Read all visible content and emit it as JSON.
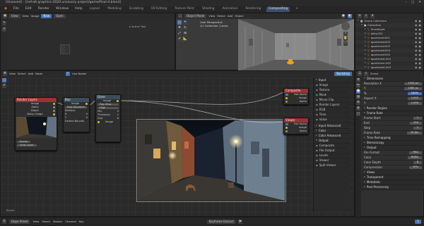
{
  "titlebar": {
    "text": "[Unsaved] - [/ref-alt-graphics-2020.unsavory project/game/final-4.blend]"
  },
  "menubar": {
    "menus": [
      "File",
      "Edit",
      "Render",
      "Window",
      "Help"
    ],
    "workspaces": [
      "Layout",
      "Modeling",
      "Sculpting",
      "UV Editing",
      "Texture Paint",
      "Shading",
      "Animation",
      "Rendering",
      "Compositing"
    ],
    "active_workspace": "Compositing"
  },
  "image_editor_top": {
    "header_items": [
      "View",
      "View",
      "Image",
      "New",
      "Open"
    ],
    "label": "Active Tool"
  },
  "viewport_3d": {
    "header": [
      "Object Mode",
      "View",
      "Select",
      "Add",
      "Object"
    ],
    "info_lines": [
      "User Perspective",
      "(1) Collection | Lamp"
    ],
    "info_text": "Collection | 0.2"
  },
  "outliner": {
    "title": "Scene Collection",
    "items": [
      {
        "name": "Scene Collection",
        "indent": 0
      },
      {
        "name": "Collection",
        "indent": 1
      },
      {
        "name": "Streetlight",
        "indent": 2
      },
      {
        "name": "alley.001",
        "indent": 2
      },
      {
        "name": "apartment001",
        "indent": 2
      },
      {
        "name": "apartment002",
        "indent": 2
      },
      {
        "name": "apartment003",
        "indent": 2
      },
      {
        "name": "apartment004",
        "indent": 2
      },
      {
        "name": "apartment005",
        "indent": 2
      },
      {
        "name": "apartment.001",
        "indent": 2
      },
      {
        "name": "apartment.002",
        "indent": 2
      },
      {
        "name": "apartment.003",
        "indent": 2
      },
      {
        "name": "apartment.004",
        "indent": 2
      }
    ]
  },
  "node_editor": {
    "header": [
      "View",
      "Select",
      "Add",
      "Node",
      "Use Nodes",
      "Backdrop"
    ],
    "nodes": {
      "render_layers": {
        "title": "Render Layers",
        "rows": [
          "Image",
          "Alpha",
          "Depth",
          "Noisy Image"
        ],
        "footer": [
          "Scene",
          "View Layer"
        ]
      },
      "blur": {
        "title": "Blur",
        "rows": [
          "Image",
          "Fast Gaussian",
          "Relative",
          "X",
          "Y",
          "Extend Bounds"
        ]
      },
      "glare": {
        "title": "Glare",
        "rows": [
          "Image",
          "Fog Glow",
          "High",
          "Mix",
          "Threshold",
          "Size"
        ]
      },
      "composite": {
        "title": "Composite",
        "rows": [
          "Use Alpha",
          "Image",
          "Alpha"
        ]
      },
      "viewer": {
        "title": "Viewer",
        "rows": [
          "Use Alpha",
          "Image",
          "Alpha"
        ]
      }
    },
    "add_menu": {
      "title": "Input",
      "items": [
        "Image",
        "Texture",
        "Mask",
        "Movie Clip",
        "Render Layers",
        "RGB",
        "Time",
        "Value"
      ],
      "sections": [
        "Input Advanced",
        "Color",
        "Color Advanced",
        "Output"
      ],
      "output_items": [
        "Composite",
        "File Output",
        "Levels",
        "Viewer",
        "Split Viewer"
      ]
    },
    "bottom_label": "Scene"
  },
  "properties": {
    "tabs": [
      "Scene"
    ],
    "sections": [
      {
        "name": "Dimensions",
        "rows": [
          [
            "Resolution X",
            "1920 px"
          ],
          [
            "Y",
            "1080 px"
          ],
          [
            "%",
            "100%"
          ],
          [
            "Aspect X",
            "1.000"
          ],
          [
            "Y",
            "1.000"
          ]
        ]
      },
      {
        "name": "Render Region",
        "rows": []
      },
      {
        "name": "Frame Rate",
        "rows": [
          [
            "Frame Start",
            "1"
          ],
          [
            "End",
            "250"
          ],
          [
            "Step",
            "1"
          ],
          [
            "Frame Rate",
            "24 fps"
          ]
        ]
      },
      {
        "name": "Time Remapping",
        "rows": []
      },
      {
        "name": "Stereoscopy",
        "rows": []
      },
      {
        "name": "Output",
        "rows": [
          [
            "File Format",
            "PNG"
          ],
          [
            "Color",
            "RGBA"
          ],
          [
            "Color Depth",
            "8"
          ],
          [
            "Compression",
            "15%"
          ]
        ]
      },
      {
        "name": "Views",
        "rows": []
      },
      {
        "name": "Transparent",
        "rows": []
      },
      {
        "name": "Metadata",
        "rows": []
      },
      {
        "name": "Post Processing",
        "rows": []
      }
    ]
  },
  "timeline": {
    "items": [
      "Dope Sheet",
      "View",
      "Select",
      "Marker",
      "Channel",
      "Key",
      "Keyframe Extract"
    ],
    "frame": "1"
  },
  "colors": {
    "accent": "#4772b3",
    "node_input": "#9b3232",
    "node_filter": "#3a4d5c",
    "node_output": "#9b3232",
    "node_converter": "#5b4f3a"
  }
}
